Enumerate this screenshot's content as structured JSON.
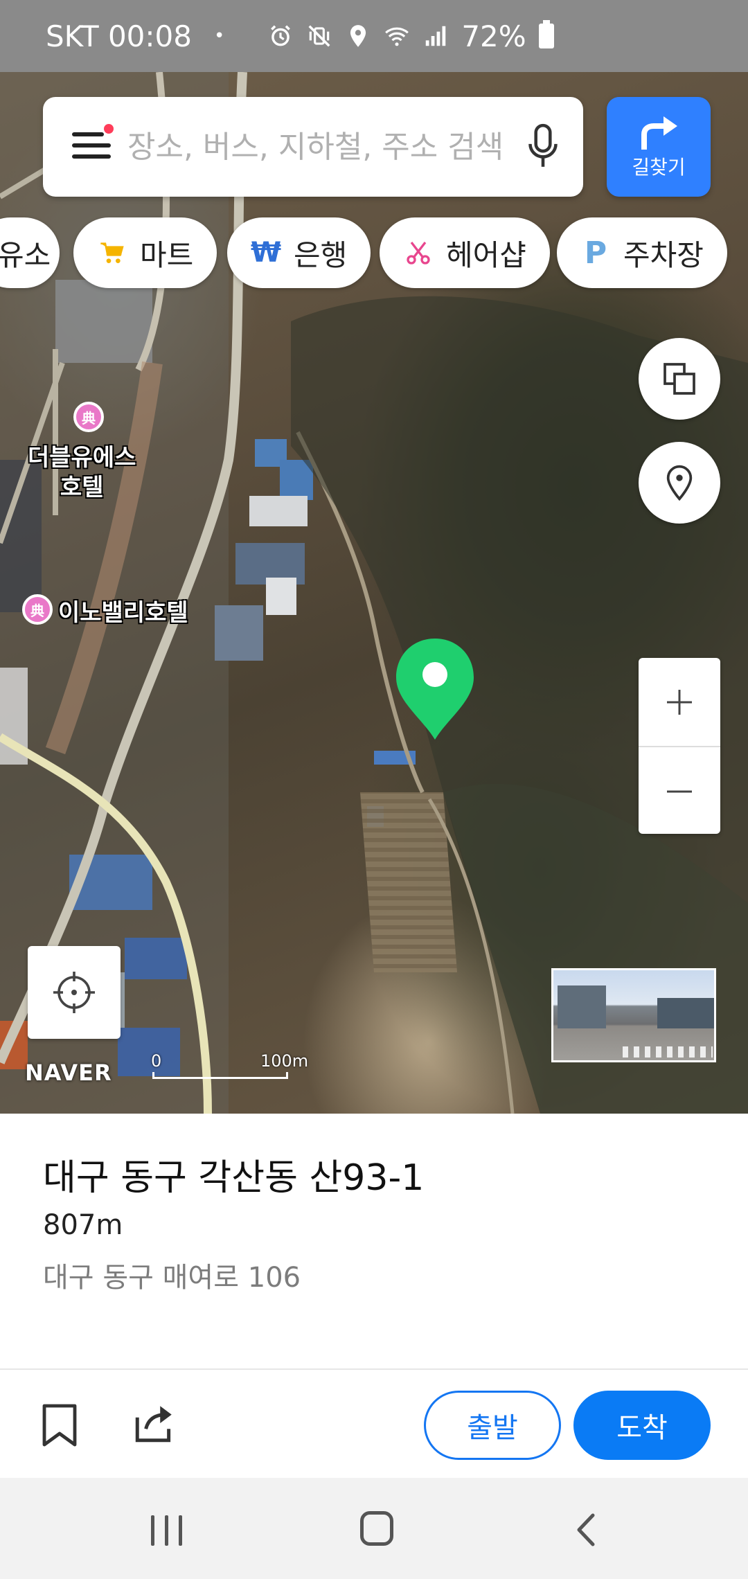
{
  "status_bar": {
    "carrier_time": "SKT 00:08",
    "dot": "•",
    "battery": "72%"
  },
  "search": {
    "placeholder": "장소, 버스, 지하철, 주소 검색",
    "route_label": "길찾기"
  },
  "categories": [
    {
      "label": "유소",
      "icon": "gas-icon"
    },
    {
      "label": "마트",
      "icon": "cart-icon",
      "color": "#f5b400"
    },
    {
      "label": "은행",
      "icon": "won-icon",
      "icon_text": "₩",
      "color": "#2f6fd6"
    },
    {
      "label": "헤어샵",
      "icon": "scissors-icon",
      "color": "#e8468e"
    },
    {
      "label": "주차장",
      "icon": "parking-icon",
      "icon_text": "P",
      "color": "#6aa9e0"
    }
  ],
  "map": {
    "labels": {
      "hotel1": "더블유에스\n호텔",
      "hotel2": "이노밸리호텔"
    },
    "poi_glyph": "典",
    "logo": "NAVER",
    "scale_start": "0",
    "scale_end": "100m",
    "pin_color": "#1fcf6e"
  },
  "place": {
    "title": "대구 동구 각산동 산93-1",
    "distance": "807m",
    "road_address": "대구 동구 매여로 106"
  },
  "actions": {
    "start_label": "출발",
    "arrive_label": "도착"
  },
  "colors": {
    "accent": "#0a7bf5",
    "route_button": "#2f80ff"
  }
}
